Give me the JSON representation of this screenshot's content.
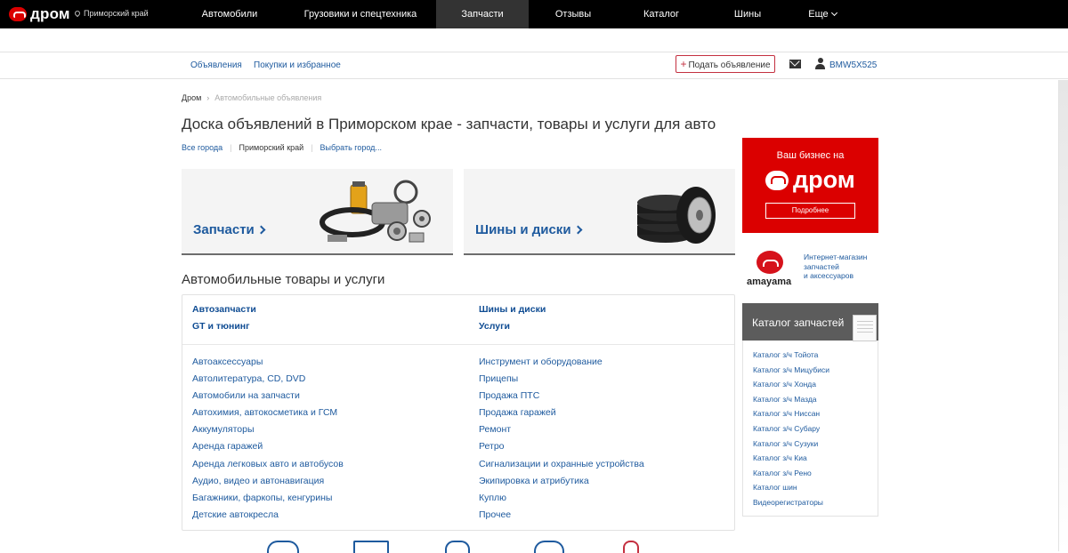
{
  "header": {
    "logo_text": "дром",
    "region": "Приморский край",
    "nav": [
      {
        "label": "Автомобили",
        "active": false
      },
      {
        "label": "Грузовики и спецтехника",
        "active": false
      },
      {
        "label": "Запчасти",
        "active": true
      },
      {
        "label": "Отзывы",
        "active": false
      },
      {
        "label": "Каталог",
        "active": false
      },
      {
        "label": "Шины",
        "active": false
      },
      {
        "label": "Еще",
        "active": false
      }
    ]
  },
  "subnav": {
    "ads": "Объявления",
    "purchases": "Покупки и избранное",
    "post_ad": "Подать объявление",
    "username": "BMW5X525"
  },
  "breadcrumb": {
    "home": "Дром",
    "separator": "›",
    "current": "Автомобильные объявления"
  },
  "page_title": "Доска объявлений в Приморском крае - запчасти, товары и услуги для авто",
  "cities": {
    "all": "Все города",
    "current": "Приморский край",
    "choose": "Выбрать город..."
  },
  "banners": {
    "parts": "Запчасти",
    "tires": "Шины и диски"
  },
  "section_title": "Автомобильные товары и услуги",
  "categories": {
    "featured_left": [
      "Автозапчасти",
      "GT и тюнинг"
    ],
    "featured_right": [
      "Шины и диски",
      "Услуги"
    ],
    "left": [
      "Автоаксессуары",
      "Автолитература, CD, DVD",
      "Автомобили на запчасти",
      "Автохимия, автокосметика и ГСМ",
      "Аккумуляторы",
      "Аренда гаражей",
      "Аренда легковых авто и автобусов",
      "Аудио, видео и автонавигация",
      "Багажники, фаркопы, кенгурины",
      "Детские автокресла"
    ],
    "right": [
      "Инструмент и оборудование",
      "Прицепы",
      "Продажа ПТС",
      "Продажа гаражей",
      "Ремонт",
      "Ретро",
      "Сигнализации и охранные устройства",
      "Экипировка и атрибутика",
      "Куплю",
      "Прочее"
    ]
  },
  "sidebar": {
    "ad": {
      "headline": "Ваш бизнес на",
      "brand": "дром",
      "button": "Подробнее",
      "color": "#db0000"
    },
    "amayama": {
      "name": "amayama",
      "desc_line1": "Интернет-магазин",
      "desc_line2": "запчастей",
      "desc_line3": "и аксессуаров"
    },
    "catalog": {
      "title": "Каталог запчастей",
      "items": [
        "Каталог з/ч Тойота",
        "Каталог з/ч Мицубиси",
        "Каталог з/ч Хонда",
        "Каталог з/ч Мазда",
        "Каталог з/ч Ниссан",
        "Каталог з/ч Субару",
        "Каталог з/ч Сузуки",
        "Каталог з/ч Киа",
        "Каталог з/ч Рено",
        "Каталог шин",
        "Видеорегистраторы"
      ]
    }
  }
}
